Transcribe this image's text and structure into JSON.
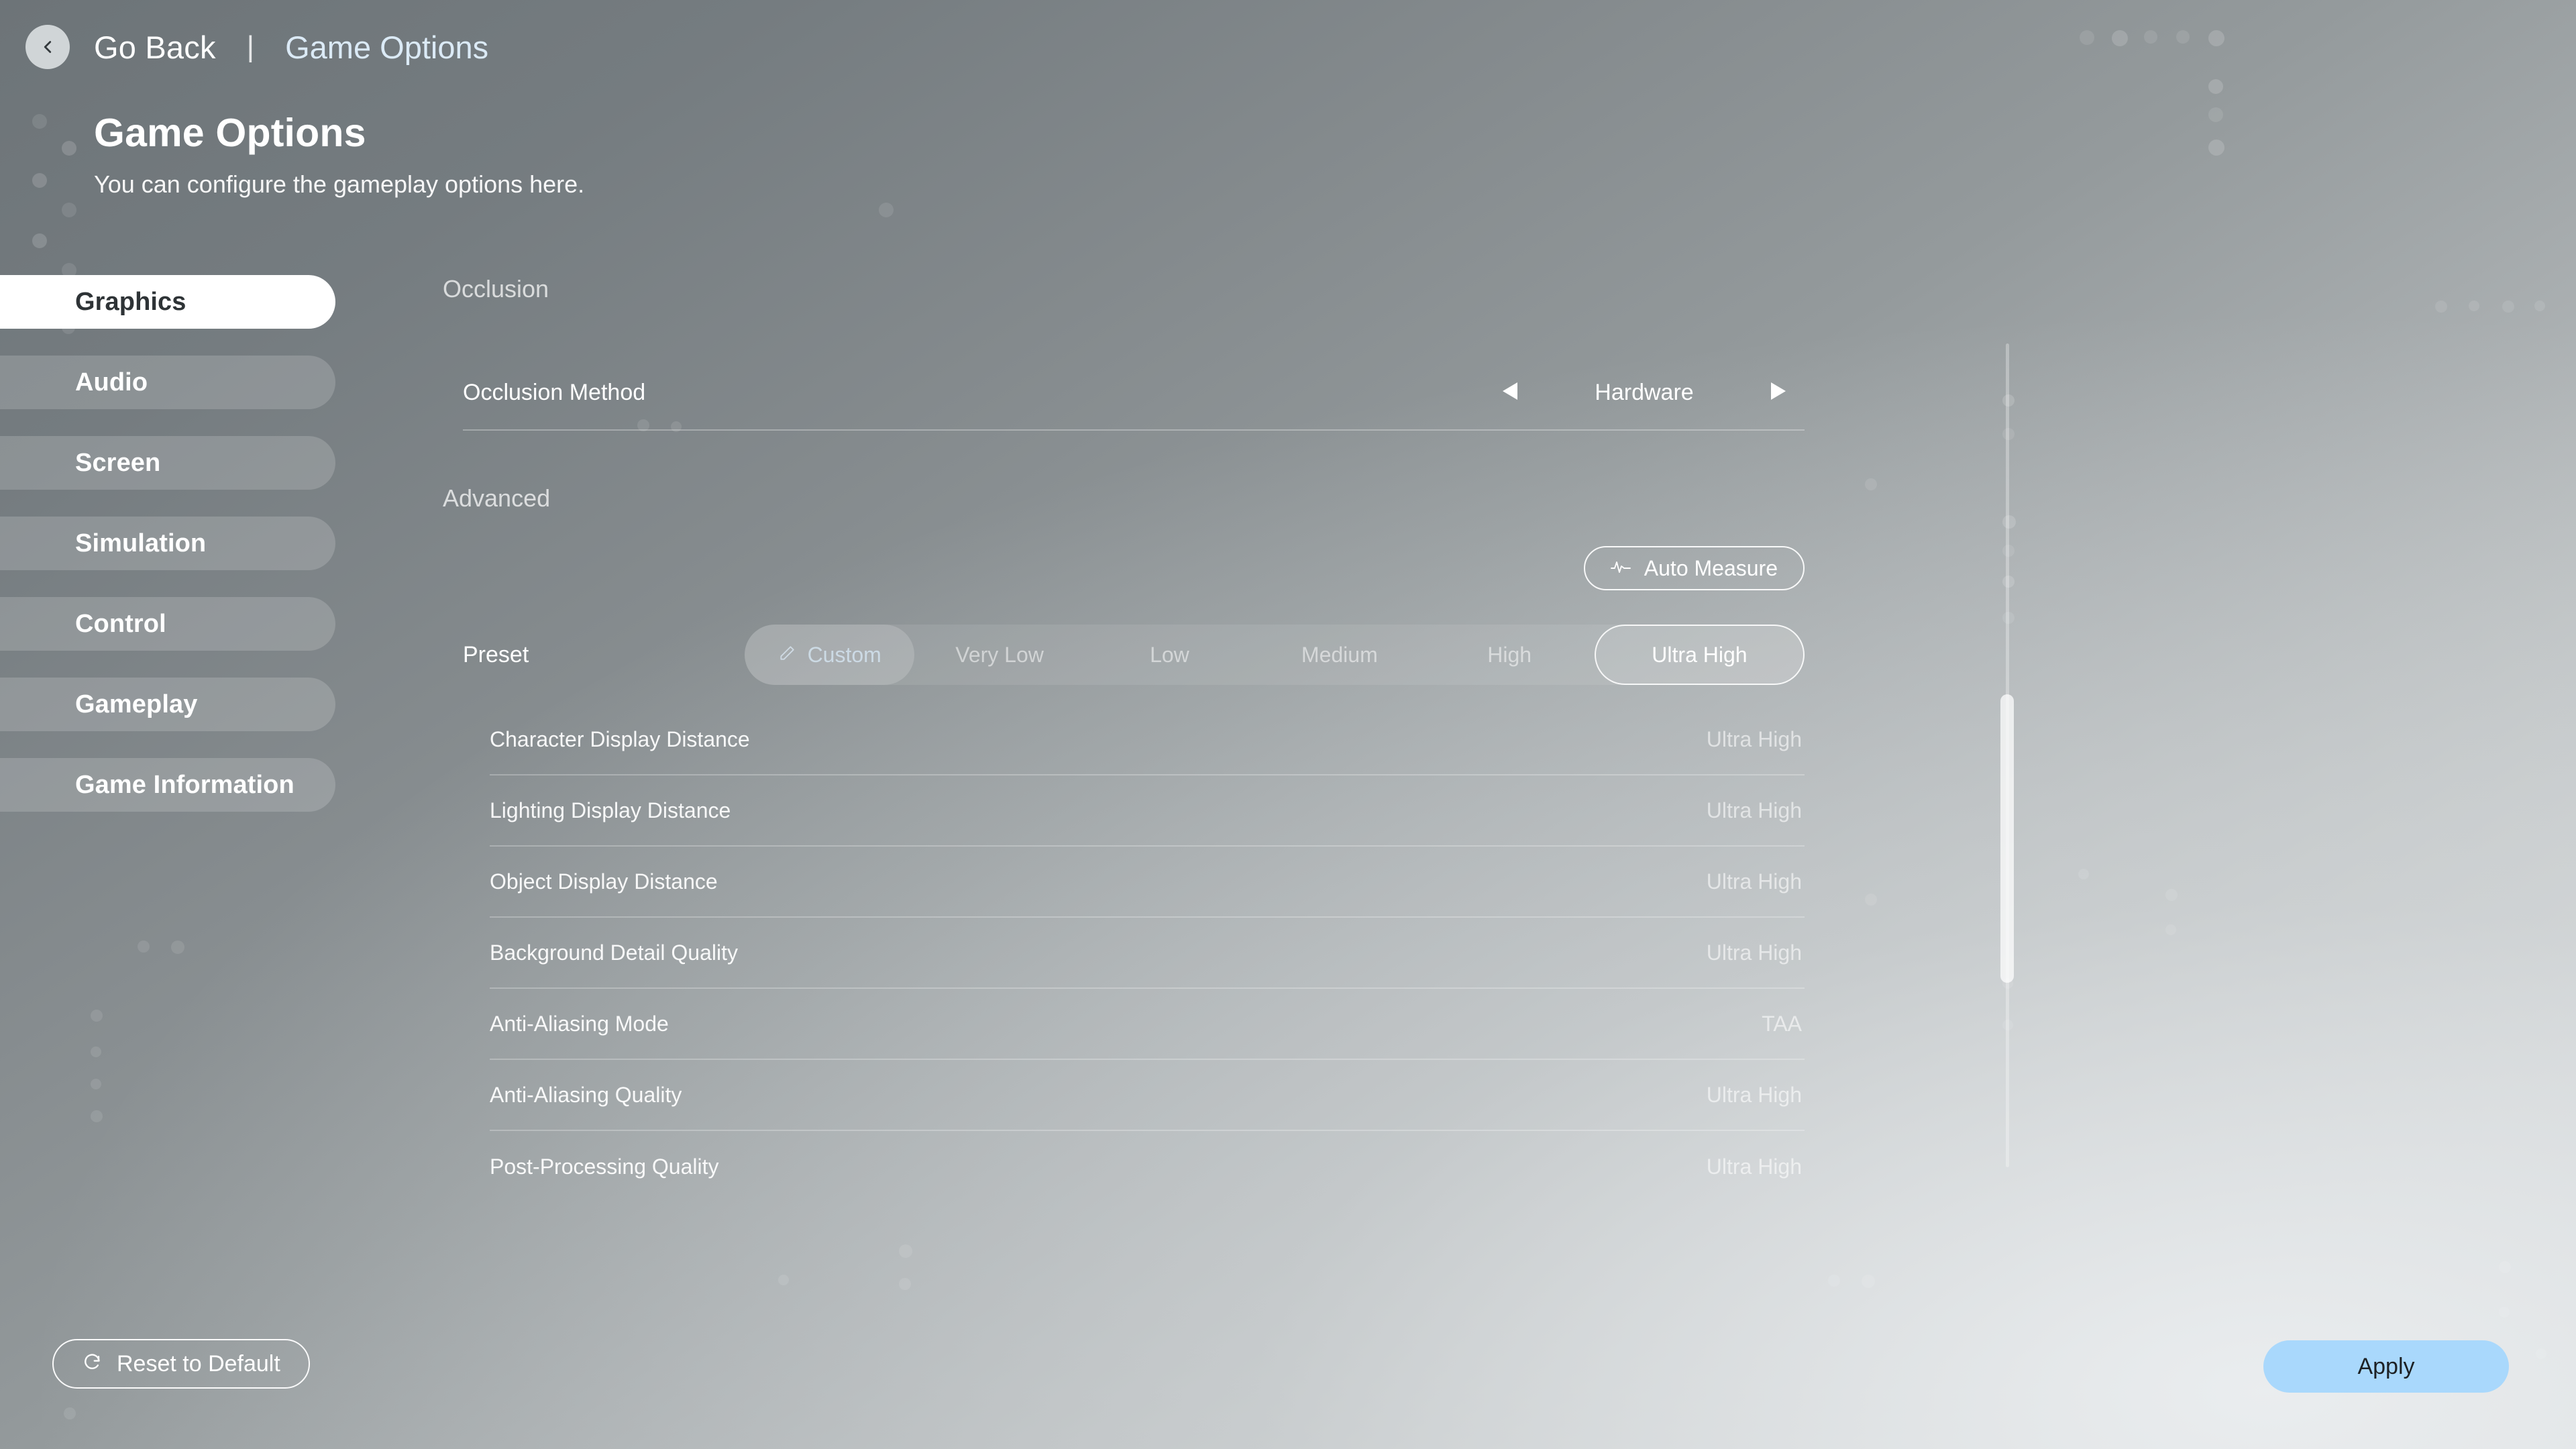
{
  "topbar": {
    "back_label": "Go Back",
    "separator": "|",
    "current_page": "Game Options",
    "back_icon": "chevron-left-icon"
  },
  "heading": {
    "title": "Game Options",
    "subtitle": "You can configure the gameplay options here."
  },
  "sidebar": {
    "items": [
      {
        "label": "Graphics",
        "active": true
      },
      {
        "label": "Audio",
        "active": false
      },
      {
        "label": "Screen",
        "active": false
      },
      {
        "label": "Simulation",
        "active": false
      },
      {
        "label": "Control",
        "active": false
      },
      {
        "label": "Gameplay",
        "active": false
      },
      {
        "label": "Game Information",
        "active": false
      }
    ]
  },
  "content": {
    "occlusion_section": {
      "title": "Occlusion",
      "row": {
        "label": "Occlusion Method",
        "value": "Hardware",
        "prev_icon": "triangle-left-icon",
        "next_icon": "triangle-right-icon"
      }
    },
    "advanced_section": {
      "title": "Advanced",
      "auto_measure": {
        "label": "Auto Measure",
        "icon": "pulse-waveform-icon"
      },
      "preset": {
        "label": "Preset",
        "custom_icon": "pencil-icon",
        "options": [
          {
            "label": "Custom",
            "state": "custom"
          },
          {
            "label": "Very Low",
            "state": "normal"
          },
          {
            "label": "Low",
            "state": "normal"
          },
          {
            "label": "Medium",
            "state": "normal"
          },
          {
            "label": "High",
            "state": "normal"
          },
          {
            "label": "Ultra High",
            "state": "selected"
          }
        ],
        "selected_value": "Ultra High"
      },
      "settings": [
        {
          "label": "Character Display Distance",
          "value": "Ultra High"
        },
        {
          "label": "Lighting Display Distance",
          "value": "Ultra High"
        },
        {
          "label": "Object Display Distance",
          "value": "Ultra High"
        },
        {
          "label": "Background Detail Quality",
          "value": "Ultra High"
        },
        {
          "label": "Anti-Aliasing Mode",
          "value": "TAA"
        },
        {
          "label": "Anti-Aliasing Quality",
          "value": "Ultra High"
        },
        {
          "label": "Post-Processing Quality",
          "value": "Ultra High"
        }
      ]
    }
  },
  "footer": {
    "reset_label": "Reset to Default",
    "reset_icon": "refresh-icon",
    "apply_label": "Apply"
  },
  "colors": {
    "accent_apply": "#a9d8fc",
    "active_nav_bg": "#ffffff",
    "crumb_current": "#dbeaf6"
  }
}
